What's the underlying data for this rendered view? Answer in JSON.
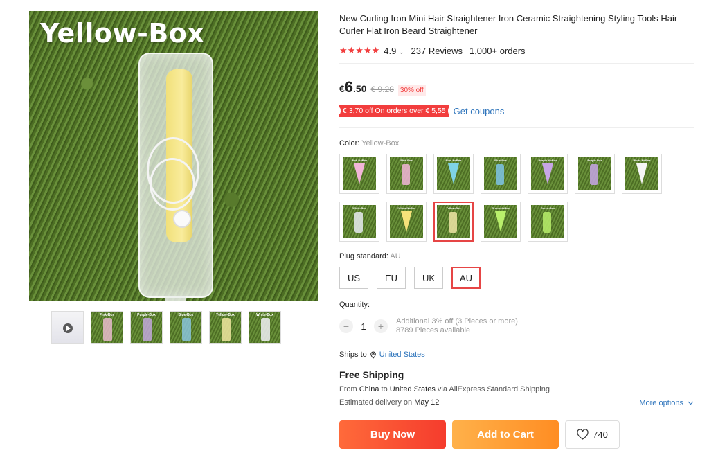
{
  "gallery": {
    "watermark": "Yellow-Box",
    "thumbnails": [
      {
        "label": ""
      },
      {
        "label": "Pink-Box"
      },
      {
        "label": "Purple-Box"
      },
      {
        "label": "Blue-Box"
      },
      {
        "label": "Yellow-Box"
      },
      {
        "label": "White-Box"
      }
    ]
  },
  "product": {
    "title": "New Curling Iron Mini Hair Straightener Iron Ceramic Straightening Styling Tools Hair Curler Flat Iron Beard Straightener",
    "rating": "4.9",
    "reviews": "237 Reviews",
    "orders": "1,000+ orders"
  },
  "price": {
    "currency": "€",
    "whole": "6",
    "fraction": ".50",
    "original": "€ 9.28",
    "discount": "30% off",
    "coupon": "€ 3,70 off On orders over € 5,55",
    "get_coupons": "Get coupons"
  },
  "color": {
    "label": "Color:",
    "value": "Yellow-Box",
    "options": [
      {
        "label": "Pink-NoBox",
        "color": "#f2b6d8",
        "shape": "v"
      },
      {
        "label": "Pink-Box",
        "color": "#f2b6d8",
        "shape": "b"
      },
      {
        "label": "Blue-NoBox",
        "color": "#7fd3e6",
        "shape": "v"
      },
      {
        "label": "Blue-Box",
        "color": "#7fc4e6",
        "shape": "b"
      },
      {
        "label": "Purple-NoBox",
        "color": "#c7a6e6",
        "shape": "v"
      },
      {
        "label": "Purple-Box",
        "color": "#c7a6e6",
        "shape": "b"
      },
      {
        "label": "White-NoBox",
        "color": "#f6f6f6",
        "shape": "v"
      },
      {
        "label": "White-Box",
        "color": "#e9ecf2",
        "shape": "b"
      },
      {
        "label": "Yellow-NoBox",
        "color": "#f5e27a",
        "shape": "v"
      },
      {
        "label": "Yellow-Box",
        "color": "#f0e6a6",
        "shape": "b",
        "selected": true
      },
      {
        "label": "Green-NoBox",
        "color": "#b9ef6b",
        "shape": "v"
      },
      {
        "label": "Green-Box",
        "color": "#b9ef6b",
        "shape": "b"
      }
    ]
  },
  "plug": {
    "label": "Plug standard:",
    "value": "AU",
    "options": [
      "US",
      "EU",
      "UK",
      "AU"
    ]
  },
  "quantity": {
    "label": "Quantity:",
    "minus": "−",
    "plus": "+",
    "value": "1",
    "note1": "Additional 3% off (3 Pieces or more)",
    "note2": "8789 Pieces available"
  },
  "shipping": {
    "ships_to": "Ships to",
    "country": "United States",
    "free": "Free Shipping",
    "from_pre": "From",
    "from_country": "China",
    "to_pre": "to",
    "to_country": "United States",
    "via": "via AliExpress Standard Shipping",
    "est_pre": "Estimated delivery on",
    "est_date": "May 12",
    "more_options": "More options"
  },
  "actions": {
    "buy_now": "Buy Now",
    "add_to_cart": "Add to Cart",
    "wishlist_count": "740"
  },
  "colors": {
    "accent_red": "#f23d3d",
    "link_blue": "#2f75bc",
    "buy_now": "#f53c2d",
    "add_to_cart": "#ff8d23"
  }
}
